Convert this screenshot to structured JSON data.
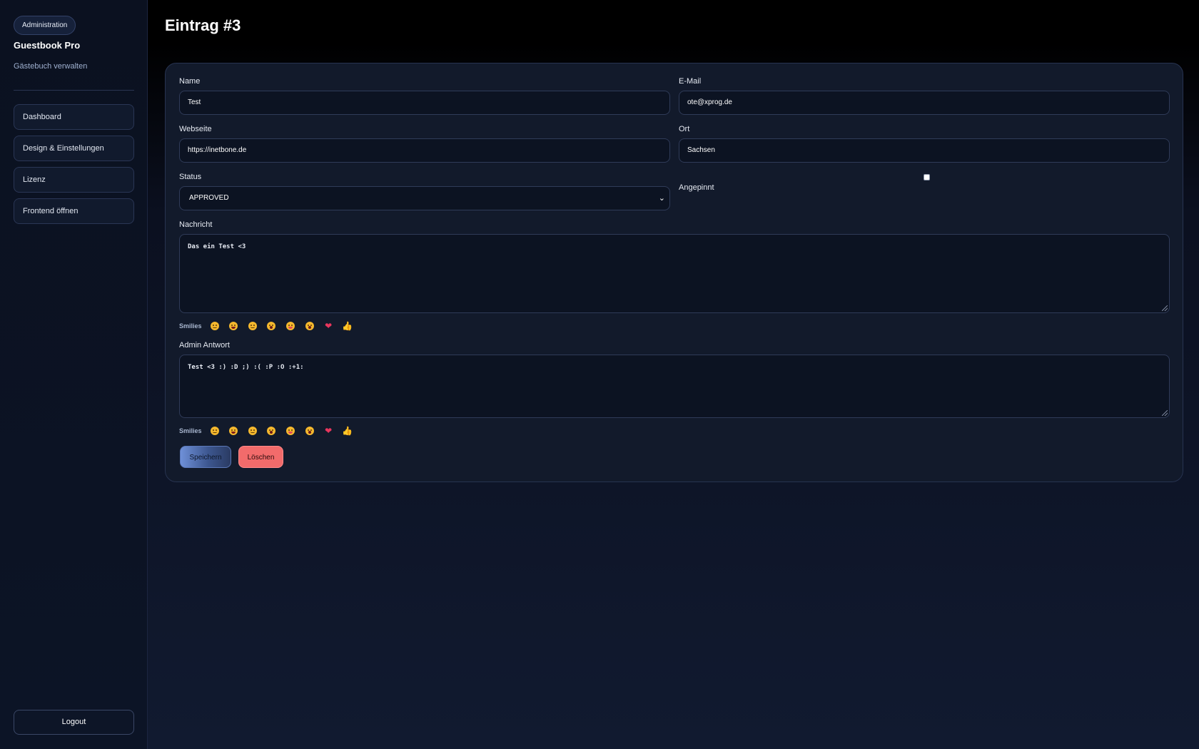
{
  "sidebar": {
    "badge": "Administration",
    "title": "Guestbook Pro",
    "subtitle": "Gästebuch verwalten",
    "items": [
      {
        "label": "Dashboard"
      },
      {
        "label": "Design & Einstellungen"
      },
      {
        "label": "Lizenz"
      },
      {
        "label": "Frontend öffnen"
      }
    ],
    "logout_label": "Logout"
  },
  "main": {
    "title": "Eintrag #3"
  },
  "form": {
    "name": {
      "label": "Name",
      "value": "Test"
    },
    "email": {
      "label": "E-Mail",
      "value": "ote@xprog.de"
    },
    "website": {
      "label": "Webseite",
      "value": "https://inetbone.de"
    },
    "location": {
      "label": "Ort",
      "value": "Sachsen"
    },
    "status": {
      "label": "Status",
      "value": "APPROVED"
    },
    "pinned": {
      "label": "Angepinnt",
      "checked": false
    },
    "message": {
      "label": "Nachricht",
      "value": "Das ein Test <3"
    },
    "admin_reply": {
      "label": "Admin Antwort",
      "value": "Test <3 :) :D ;) :( :P :O :+1:"
    },
    "smilies_label": "Smilies",
    "smilies": [
      "smile",
      "grin",
      "wink",
      "sad",
      "tongue",
      "surprised",
      "heart",
      "thumbs-up"
    ],
    "save_label": "Speichern",
    "delete_label": "Löschen"
  },
  "colors": {
    "accent": "#6f90d8",
    "danger": "#f26b6b",
    "card": "#121a2b",
    "background": "#0b1020"
  }
}
